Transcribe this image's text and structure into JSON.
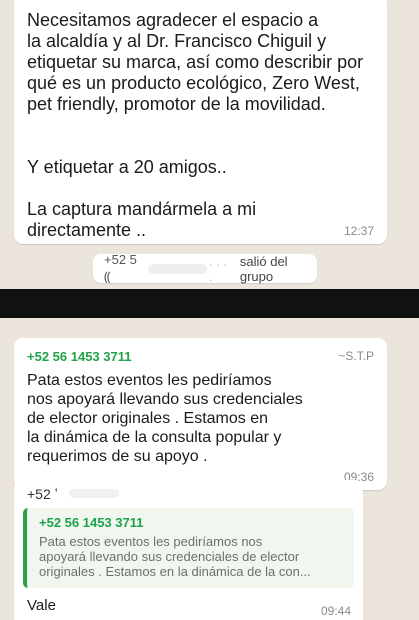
{
  "top": {
    "message": {
      "text": "Necesitamos agradecer el espacio a\nla alcaldía y al Dr. Francisco Chiguil y\netiquetar su marca, así como describir por\nqué es un producto ecológico, Zero West,\npet friendly, promotor de la movilidad.\n\n\nY etiquetar a 20 amigos..\n\nLa captura mandármela a mi\ndirectamente ..",
      "time": "12:37"
    },
    "system": {
      "number": "+52 5 ⸨",
      "dots": ". . . .",
      "label": "salió del grupo"
    }
  },
  "bottom": {
    "message": {
      "sender": "+52 56 1453 3711",
      "pushname": "~S.T.P",
      "text": "Pata estos eventos les pediríamos\nnos apoyará llevando sus credenciales\nde elector originales . Estamos en\nla dinámica de la consulta popular y\nrequerimos de su apoyo .",
      "time": "09:36"
    },
    "reply": {
      "number": "+52 ʽ",
      "quote_sender": "+52 56 1453 3711",
      "quote_text": "Pata estos eventos les pediríamos nos\napoyará llevando sus credenciales de elector\noriginales . Estamos en la dinámica de la con...",
      "text": "Vale",
      "time": "09:44"
    }
  },
  "colors": {
    "chat_bg": "#ece5dd",
    "divider": "#111111",
    "sender_green": "#1fa34a"
  }
}
